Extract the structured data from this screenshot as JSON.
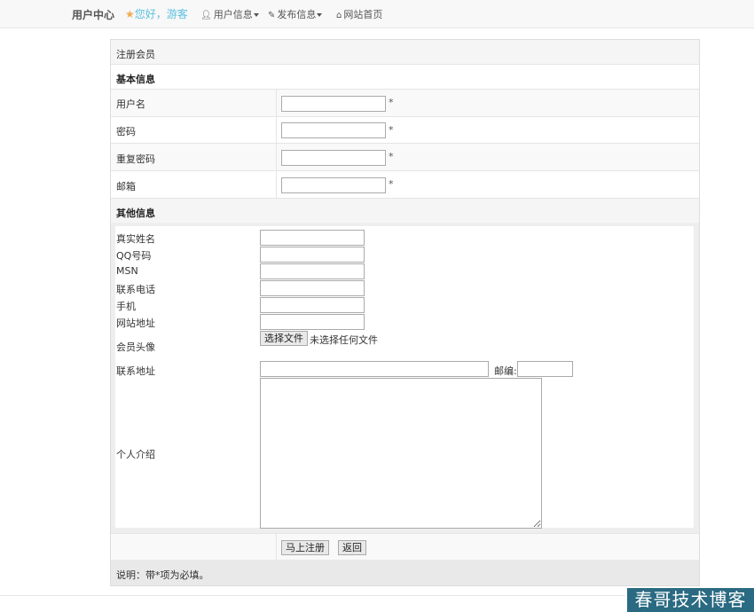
{
  "navbar": {
    "brand": "用户中心",
    "greeting": "您好，游客",
    "user_info": "用户信息",
    "publish_info": "发布信息",
    "home": "网站首页"
  },
  "form": {
    "title": "注册会员",
    "section_basic": "基本信息",
    "username": "用户名",
    "password": "密码",
    "password_repeat": "重复密码",
    "email": "邮箱",
    "required_mark": "*",
    "section_other": "其他信息",
    "real_name": "真实姓名",
    "qq": "QQ号码",
    "msn": "MSN",
    "phone": "联系电话",
    "mobile": "手机",
    "website": "网站地址",
    "avatar": "会员头像",
    "choose_file": "选择文件",
    "no_file": "未选择任何文件",
    "address": "联系地址",
    "postcode": "邮编:",
    "bio": "个人介绍",
    "submit": "马上注册",
    "back": "返回",
    "note": "说明：带*项为必填。"
  },
  "watermark": "春哥技术博客"
}
